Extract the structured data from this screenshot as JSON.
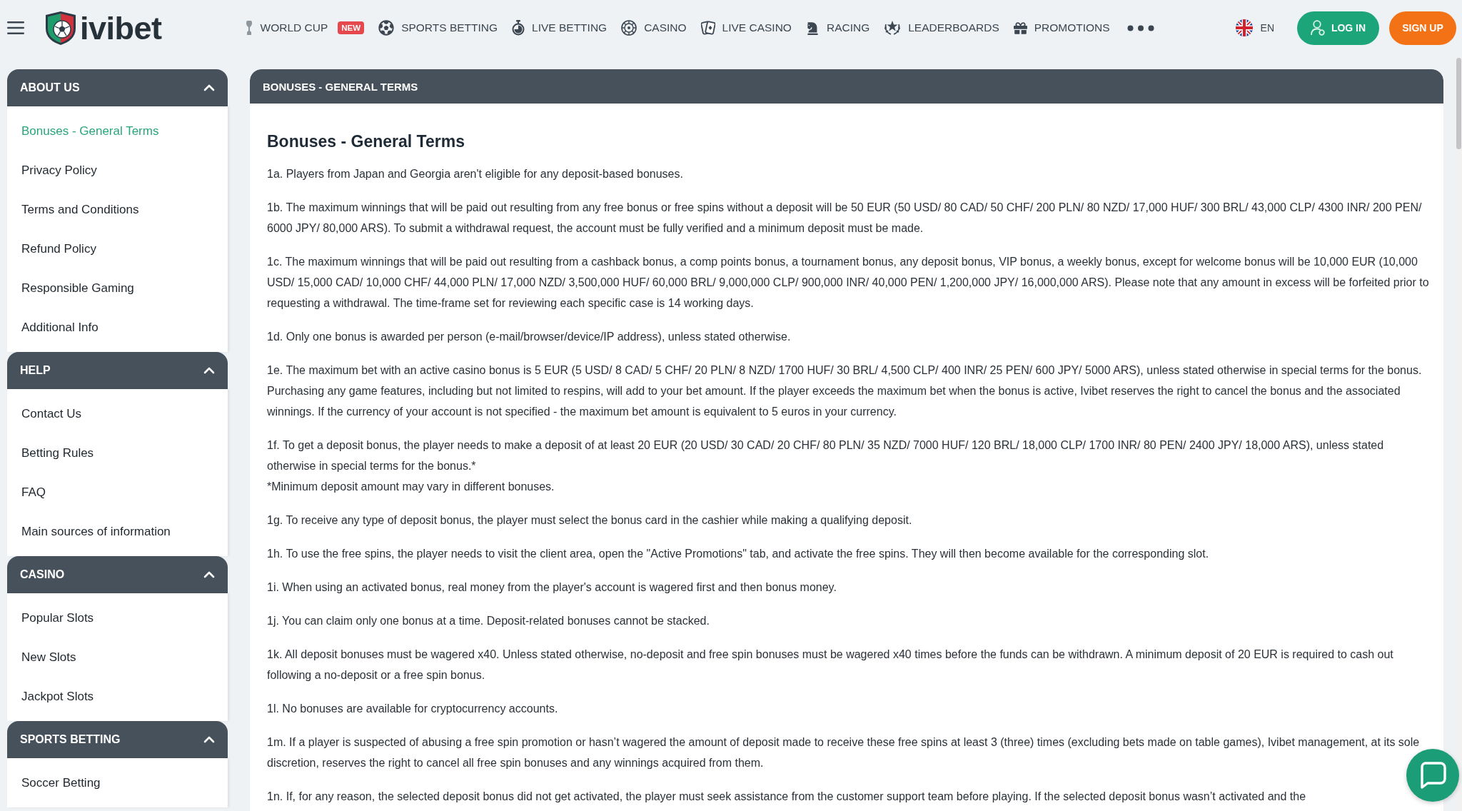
{
  "header": {
    "logo_text": "ivibet",
    "nav": [
      {
        "label": "WORLD CUP",
        "badge": "NEW"
      },
      {
        "label": "SPORTS BETTING"
      },
      {
        "label": "LIVE BETTING"
      },
      {
        "label": "CASINO"
      },
      {
        "label": "LIVE CASINO"
      },
      {
        "label": "RACING"
      },
      {
        "label": "LEADERBOARDS"
      },
      {
        "label": "PROMOTIONS"
      }
    ],
    "language": "EN",
    "login": "LOG IN",
    "signup": "SIGN UP"
  },
  "sidebar": {
    "sections": [
      {
        "title": "ABOUT US",
        "expanded": true,
        "items": [
          {
            "label": "Bonuses - General Terms",
            "selected": true
          },
          {
            "label": "Privacy Policy",
            "selected": false
          },
          {
            "label": "Terms and Conditions",
            "selected": false
          },
          {
            "label": "Refund Policy",
            "selected": false
          },
          {
            "label": "Responsible Gaming",
            "selected": false
          },
          {
            "label": "Additional Info",
            "selected": false
          }
        ]
      },
      {
        "title": "HELP",
        "expanded": true,
        "items": [
          {
            "label": "Contact Us",
            "selected": false
          },
          {
            "label": "Betting Rules",
            "selected": false
          },
          {
            "label": "FAQ",
            "selected": false
          },
          {
            "label": "Main sources of information",
            "selected": false
          }
        ]
      },
      {
        "title": "CASINO",
        "expanded": true,
        "items": [
          {
            "label": "Popular Slots",
            "selected": false
          },
          {
            "label": "New Slots",
            "selected": false
          },
          {
            "label": "Jackpot Slots",
            "selected": false
          }
        ]
      },
      {
        "title": "SPORTS BETTING",
        "expanded": true,
        "items": [
          {
            "label": "Soccer Betting",
            "selected": false
          }
        ]
      }
    ]
  },
  "content": {
    "panel_title": "BONUSES - GENERAL TERMS",
    "heading": "Bonuses - General Terms",
    "paragraphs": [
      {
        "text": "1a. Players from Japan and Georgia aren't eligible for any deposit-based bonuses."
      },
      {
        "text": "1b. The maximum winnings that will be paid out resulting from any free bonus or free spins without a deposit will be 50 EUR (50 USD/ 80 CAD/ 50 CHF/ 200 PLN/ 80 NZD/ 17,000 HUF/ 300 BRL/ 43,000 CLP/ 4300 INR/ 200 PEN/ 6000 JPY/ 80,000 ARS). To submit a withdrawal request, the account must be fully verified and a minimum deposit must be made."
      },
      {
        "text": "1c. The maximum winnings that will be paid out resulting from a cashback bonus, a comp points bonus, a tournament bonus, any deposit bonus, VIP bonus, a weekly bonus, except for welcome bonus will be 10,000 EUR (10,000 USD/ 15,000 CAD/ 10,000 CHF/ 44,000 PLN/ 17,000 NZD/ 3,500,000 HUF/ 60,000 BRL/ 9,000,000 CLP/ 900,000 INR/ 40,000 PEN/ 1,200,000 JPY/ 16,000,000 ARS). Please note that any amount in excess will be forfeited prior to requesting a withdrawal. The time-frame set for reviewing each specific case is 14 working days."
      },
      {
        "text": "1d. Only one bonus is awarded per person (e-mail/browser/device/IP address), unless stated otherwise."
      },
      {
        "text": "1e. The maximum bet with an active casino bonus is 5 EUR (5 USD/ 8 CAD/ 5 CHF/ 20 PLN/ 8 NZD/ 1700 HUF/ 30 BRL/ 4,500 CLP/ 400 INR/ 25 PEN/ 600 JPY/ 5000 ARS), unless stated otherwise in special terms for the bonus. Purchasing any game features, including but not limited to respins, will add to your bet amount. If the player exceeds the maximum bet when the bonus is active, Ivibet reserves the right to cancel the bonus and the associated winnings. If the currency of your account is not specified - the maximum bet amount is equivalent to 5 euros in your currency."
      },
      {
        "text": "1f. To get a deposit bonus, the player needs to make a deposit of at least 20 EUR (20 USD/ 30 CAD/ 20 CHF/ 80 PLN/ 35 NZD/ 7000 HUF/ 120 BRL/ 18,000 CLP/ 1700 INR/ 80 PEN/ 2400 JPY/ 18,000 ARS), unless stated otherwise in special terms for the bonus.*",
        "note": "*Minimum deposit amount may vary in different bonuses."
      },
      {
        "text": "1g. To receive any type of deposit bonus, the player must select the bonus card in the cashier while making a qualifying deposit."
      },
      {
        "text": "1h. To use the free spins, the player needs to visit the client area, open the \"Active Promotions\" tab, and activate the free spins. They will then become available for the corresponding slot."
      },
      {
        "text": "1i. When using an activated bonus, real money from the player's account is wagered first and then bonus money."
      },
      {
        "text": "1j. You can claim only one bonus at a time. Deposit-related bonuses cannot be stacked."
      },
      {
        "text": "1k. All deposit bonuses must be wagered x40. Unless stated otherwise, no-deposit and free spin bonuses must be wagered x40 times before the funds can be withdrawn. A minimum deposit of 20 EUR is required to cash out following a no-deposit or a free spin bonus."
      },
      {
        "text": "1l. No bonuses are available for cryptocurrency accounts."
      },
      {
        "text": "1m. If a player is suspected of abusing a free spin promotion or hasn’t wagered the amount of deposit made to receive these free spins at least 3 (three) times (excluding bets made on table games), Ivibet management, at its sole discretion, reserves the right to cancel all free spin bonuses and any winnings acquired from them."
      },
      {
        "text": "1n. If, for any reason, the selected deposit bonus did not get activated, the player must seek assistance from the customer support team before playing. If the selected deposit bonus wasn’t activated and the"
      }
    ]
  }
}
